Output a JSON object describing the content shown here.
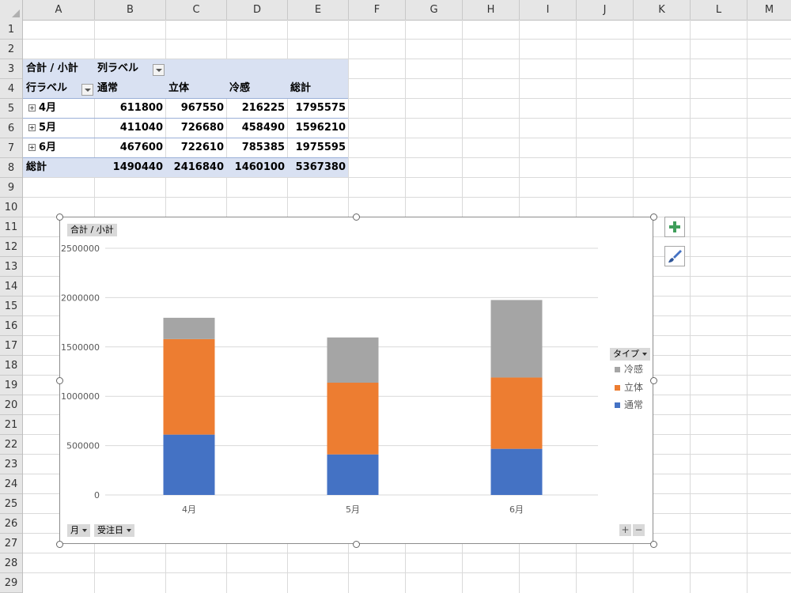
{
  "columns": [
    "A",
    "B",
    "C",
    "D",
    "E",
    "F",
    "G",
    "H",
    "I",
    "J",
    "K",
    "L",
    "M"
  ],
  "rows": [
    "1",
    "2",
    "3",
    "4",
    "5",
    "6",
    "7",
    "8",
    "9",
    "10",
    "11",
    "12",
    "13",
    "14",
    "15",
    "16",
    "17",
    "18",
    "19",
    "20",
    "21",
    "22",
    "23",
    "24",
    "25",
    "26",
    "27",
    "28",
    "29"
  ],
  "pivot": {
    "label_sum": "合計 / 小計",
    "label_col": "列ラベル",
    "label_row": "行ラベル",
    "headers": [
      "通常",
      "立体",
      "冷感",
      "総計"
    ],
    "rows": [
      {
        "label": "4月",
        "values": [
          "611800",
          "967550",
          "216225",
          "1795575"
        ]
      },
      {
        "label": "5月",
        "values": [
          "411040",
          "726680",
          "458490",
          "1596210"
        ]
      },
      {
        "label": "6月",
        "values": [
          "467600",
          "722610",
          "785385",
          "1975595"
        ]
      }
    ],
    "total": {
      "label": "総計",
      "values": [
        "1490440",
        "2416840",
        "1460100",
        "5367380"
      ]
    }
  },
  "chart_buttons": {
    "value_field": "合計 / 小計",
    "legend_field": "タイプ",
    "axis_fields": [
      "月",
      "受注日"
    ],
    "plus": "+",
    "minus": "−"
  },
  "colors": {
    "normal": "#4472c4",
    "rittai": "#ed7d31",
    "reikan": "#a5a5a5",
    "pivot_band": "#d9e1f2"
  },
  "chart_data": {
    "type": "bar",
    "stacked": true,
    "categories": [
      "4月",
      "5月",
      "6月"
    ],
    "series": [
      {
        "name": "通常",
        "values": [
          611800,
          411040,
          467600
        ]
      },
      {
        "name": "立体",
        "values": [
          967550,
          726680,
          722610
        ]
      },
      {
        "name": "冷感",
        "values": [
          216225,
          458490,
          785385
        ]
      }
    ],
    "ylim": [
      0,
      2500000
    ],
    "yticks": [
      "0",
      "500000",
      "1000000",
      "1500000",
      "2000000",
      "2500000"
    ],
    "legend": "right",
    "grid": true
  }
}
